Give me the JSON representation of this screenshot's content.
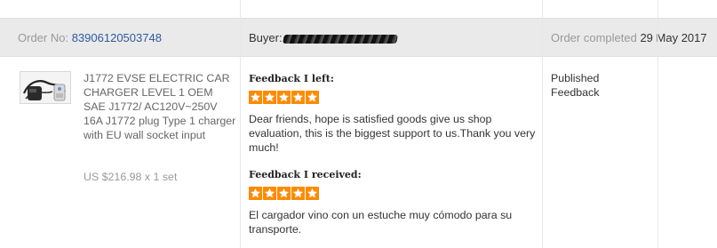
{
  "order": {
    "number_label": "Order No:",
    "number": "83906120503748",
    "buyer_label": "Buyer:",
    "status": "Order completed",
    "date": "29 May 2017"
  },
  "product": {
    "title": "J1772 EVSE ELECTRIC CAR CHARGER LEVEL 1 OEM SAE J1772/ AC120V~250V 16A J1772 plug Type 1 charger with EU wall socket input",
    "price": "US $216.98 x 1 set"
  },
  "feedback_left": {
    "label": "Feedback I left:",
    "rating": 5,
    "text": "Dear friends, hope is satisfied goods give us shop evaluation, this is the biggest support to us.Thank you very much!"
  },
  "feedback_received": {
    "label": "Feedback I received:",
    "rating": 5,
    "text": "El cargador vino con un estuche muy cómodo para su transporte."
  },
  "status_column": {
    "line1": "Published",
    "line2": "Feedback"
  },
  "colors": {
    "star": "#ff8a00",
    "link": "#2c5aa0",
    "header_bg": "#eaeaea"
  }
}
